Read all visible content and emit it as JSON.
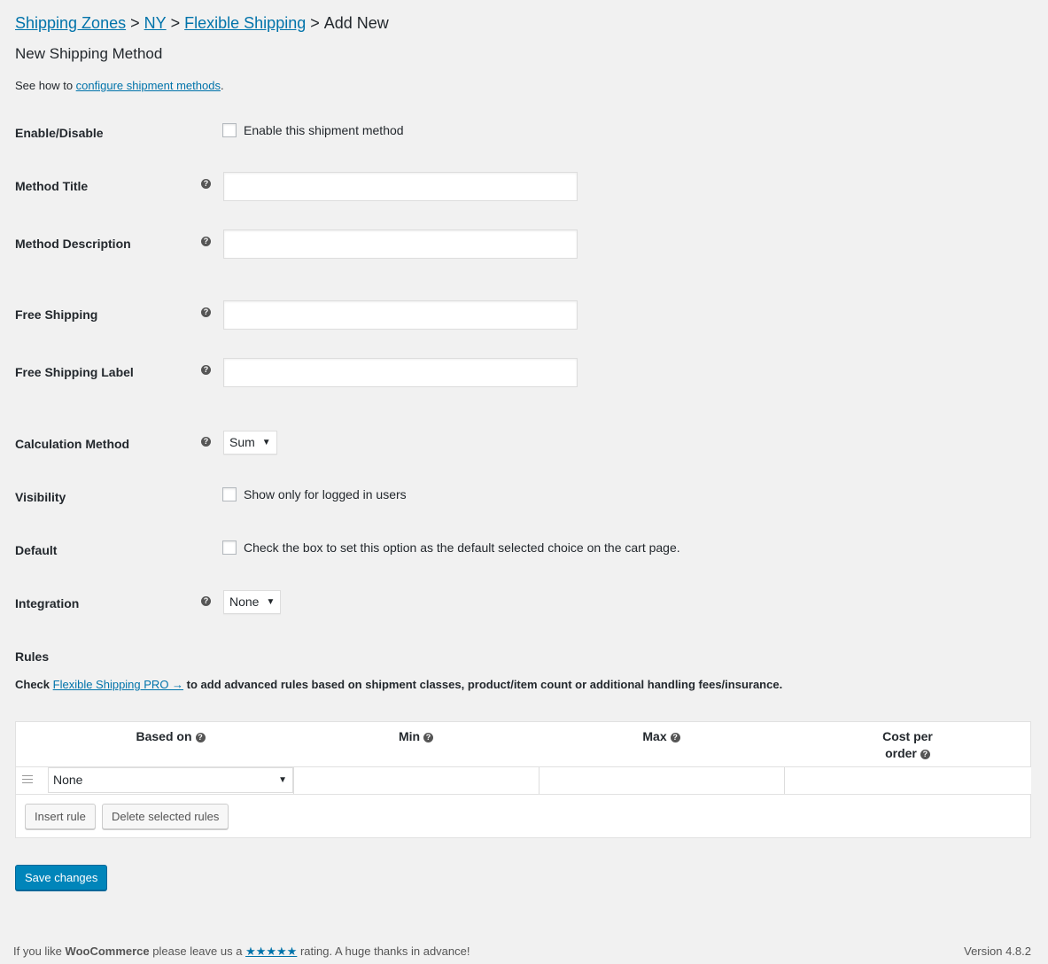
{
  "breadcrumb": {
    "items": [
      "Shipping Zones",
      "NY",
      "Flexible Shipping"
    ],
    "separator": ">",
    "current": "Add New"
  },
  "page_title": "New Shipping Method",
  "see_how": {
    "prefix": "See how to ",
    "link": "configure shipment methods",
    "suffix": "."
  },
  "fields": {
    "enable": {
      "label": "Enable/Disable",
      "checkbox_label": "Enable this shipment method"
    },
    "method_title": {
      "label": "Method Title",
      "value": ""
    },
    "method_description": {
      "label": "Method Description",
      "value": ""
    },
    "free_shipping": {
      "label": "Free Shipping",
      "value": ""
    },
    "free_shipping_label": {
      "label": "Free Shipping Label",
      "value": ""
    },
    "calculation_method": {
      "label": "Calculation Method",
      "value": "Sum"
    },
    "visibility": {
      "label": "Visibility",
      "checkbox_label": "Show only for logged in users"
    },
    "default": {
      "label": "Default",
      "checkbox_label": "Check the box to set this option as the default selected choice on the cart page."
    },
    "integration": {
      "label": "Integration",
      "value": "None"
    }
  },
  "rules": {
    "label": "Rules",
    "note_prefix": "Check ",
    "note_link": "Flexible Shipping PRO →",
    "note_suffix": " to add advanced rules based on shipment classes, product/item count or additional handling fees/insurance.",
    "columns": {
      "based_on": "Based on",
      "min": "Min",
      "max": "Max",
      "cost_line1": "Cost per",
      "cost_line2": "order"
    },
    "row": {
      "based_on": "None"
    },
    "insert_button": "Insert rule",
    "delete_button": "Delete selected rules"
  },
  "save_button": "Save changes",
  "footer": {
    "prefix": "If you like ",
    "brand": "WooCommerce",
    "middle": " please leave us a ",
    "stars": "★★★★★",
    "suffix": " rating. A huge thanks in advance!",
    "version": "Version 4.8.2"
  },
  "icons": {
    "help": "help-icon",
    "drag": "drag-handle-icon",
    "dropdown": "chevron-down-icon"
  },
  "colors": {
    "link": "#0073aa",
    "primary": "#0085ba",
    "background": "#f1f1f1"
  }
}
